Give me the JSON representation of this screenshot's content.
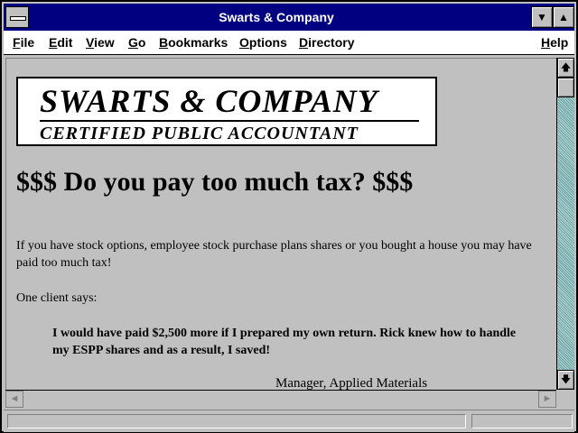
{
  "window": {
    "title": "Swarts & Company",
    "minimize_glyph": "▼",
    "maximize_glyph": "▲"
  },
  "menu": {
    "items": [
      {
        "key": "F",
        "rest": "ile"
      },
      {
        "key": "E",
        "rest": "dit"
      },
      {
        "key": "V",
        "rest": "iew"
      },
      {
        "key": "G",
        "rest": "o"
      },
      {
        "key": "B",
        "rest": "ookmarks"
      },
      {
        "key": "O",
        "rest": "ptions"
      },
      {
        "key": "D",
        "rest": "irectory"
      }
    ],
    "help": {
      "key": "H",
      "rest": "elp"
    }
  },
  "page": {
    "logo": {
      "name": "SWARTS & COMPANY",
      "subtitle": "CERTIFIED PUBLIC ACCOUNTANT"
    },
    "headline": "$$$ Do you pay too much tax? $$$",
    "intro": "If you have stock options, employee stock purchase plans shares or you bought a house you may have paid too much tax!",
    "client_says": "One client says:",
    "quote": "I would have paid $2,500 more if I prepared my own return. Rick knew how to handle my ESPP shares and as a result, I saved!",
    "signature": "Manager, Applied Materials"
  },
  "scrollbars": {
    "up_glyph": "🡅",
    "down_glyph": "🡇",
    "left_glyph": "◄",
    "right_glyph": "►"
  },
  "status": {
    "text": ""
  }
}
